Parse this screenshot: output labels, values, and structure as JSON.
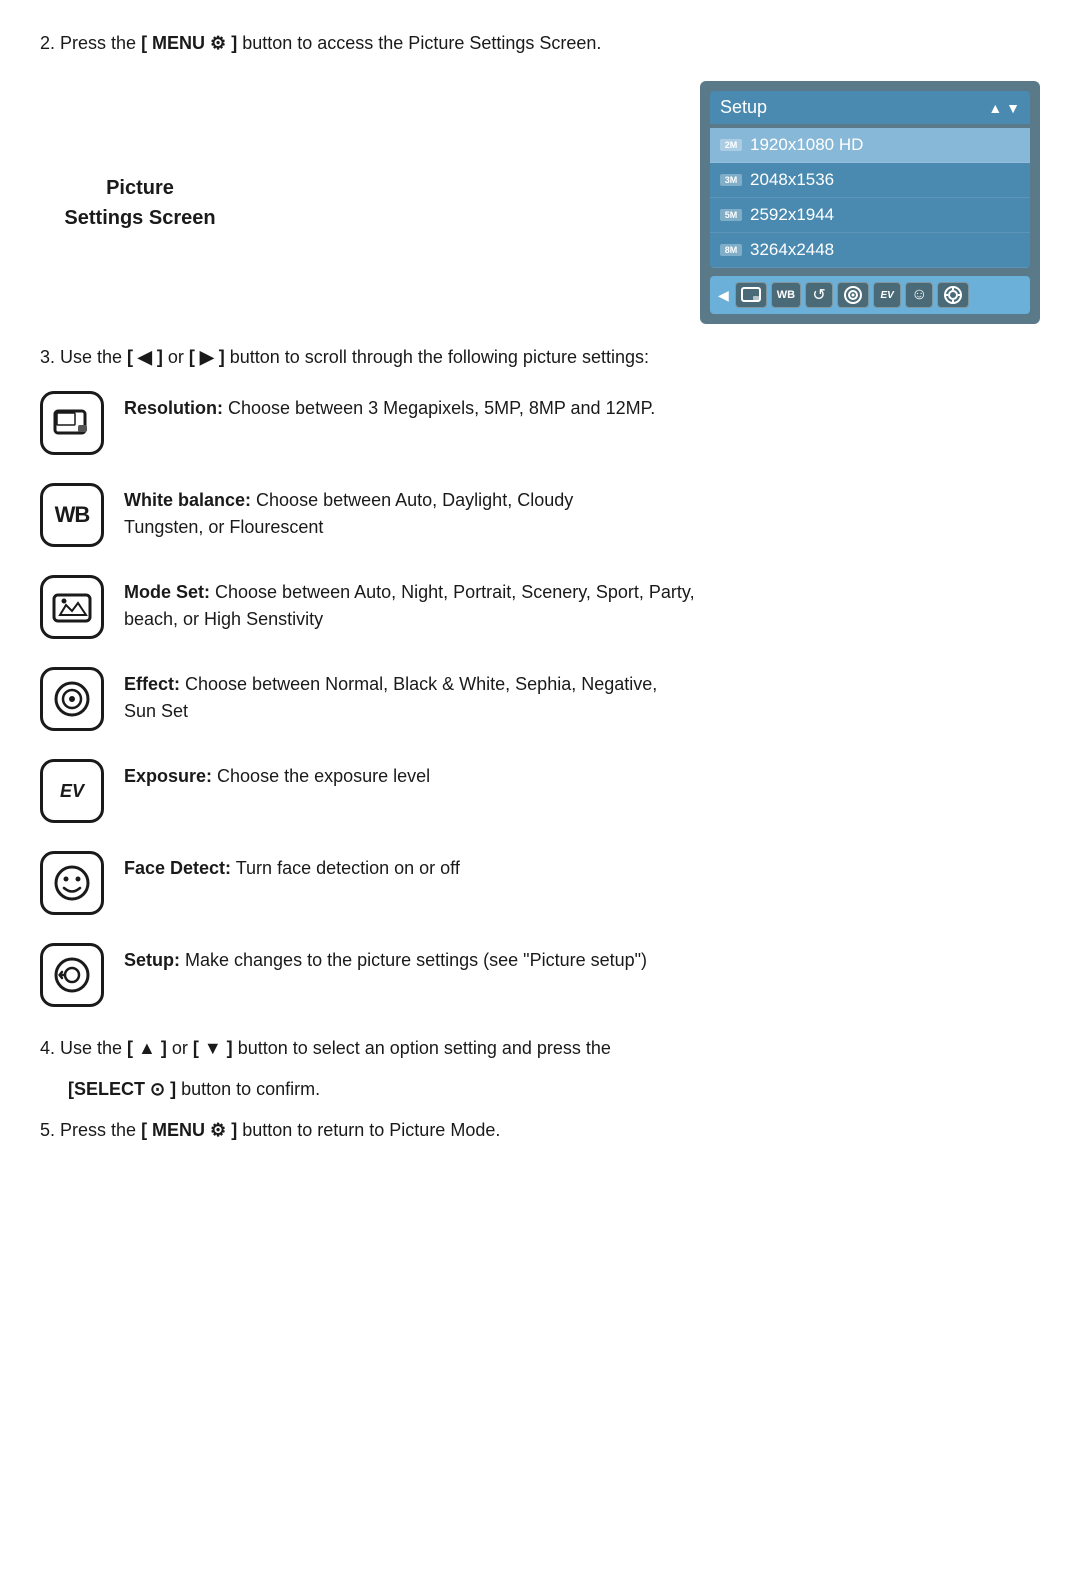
{
  "steps": {
    "step2": "2. Press the [ MENU ⚙ ] button to access the Picture Settings Screen.",
    "step3": "3. Use the [ ◀ ] or [ ▶ ] button to scroll through the following picture settings:",
    "step4": "4. Use the [ ▲ ] or [ ▼ ] button to select an option setting and press the",
    "step4b": "[SELECT ⊙ ] button to confirm.",
    "step5": "5. Press the [ MENU ⚙ ] button to return to Picture Mode."
  },
  "picture_settings_label_line1": "Picture",
  "picture_settings_label_line2": "Settings Screen",
  "camera_ui": {
    "header": "Setup",
    "arrows": "▲ ▼",
    "items": [
      {
        "badge": "2M",
        "label": "1920x1080 HD",
        "selected": true
      },
      {
        "badge": "3M",
        "label": "2048x1536",
        "selected": false
      },
      {
        "badge": "5M",
        "label": "2592x1944",
        "selected": false
      },
      {
        "badge": "8M",
        "label": "3264x2448",
        "selected": false
      }
    ],
    "left_arrow": "◀",
    "bottom_icons": [
      "📷",
      "WB",
      "↺",
      "⊙",
      "EV",
      "☺",
      "⊕"
    ]
  },
  "settings": [
    {
      "id": "resolution",
      "icon_type": "resolution",
      "icon_unicode": "📷",
      "label": "Resolution:",
      "description": "Choose between 3 Megapixels, 5MP, 8MP and 12MP."
    },
    {
      "id": "white-balance",
      "icon_type": "wb",
      "icon_unicode": "WB",
      "label": "White balance:",
      "description": "Choose between Auto, Daylight, Cloudy Tungsten, or Flourescent"
    },
    {
      "id": "mode-set",
      "icon_type": "mode",
      "icon_unicode": "↺",
      "label": "Mode Set:",
      "description": "Choose between Auto, Night, Portrait, Scenery, Sport, Party, beach, or High Senstivity"
    },
    {
      "id": "effect",
      "icon_type": "effect",
      "icon_unicode": "⊙",
      "label": "Effect:",
      "description": "Choose between Normal, Black & White, Sephia, Negative, Sun Set"
    },
    {
      "id": "exposure",
      "icon_type": "ev",
      "icon_unicode": "EV",
      "label": "Exposure:",
      "description": "Choose the exposure level"
    },
    {
      "id": "face-detect",
      "icon_type": "face",
      "icon_unicode": "☺",
      "label": "Face Detect:",
      "description": "Turn face detection on or off"
    },
    {
      "id": "setup",
      "icon_type": "setup",
      "icon_unicode": "⊕",
      "label": "Setup:",
      "description": "Make changes to the picture settings (see \"Picture setup\")"
    }
  ]
}
